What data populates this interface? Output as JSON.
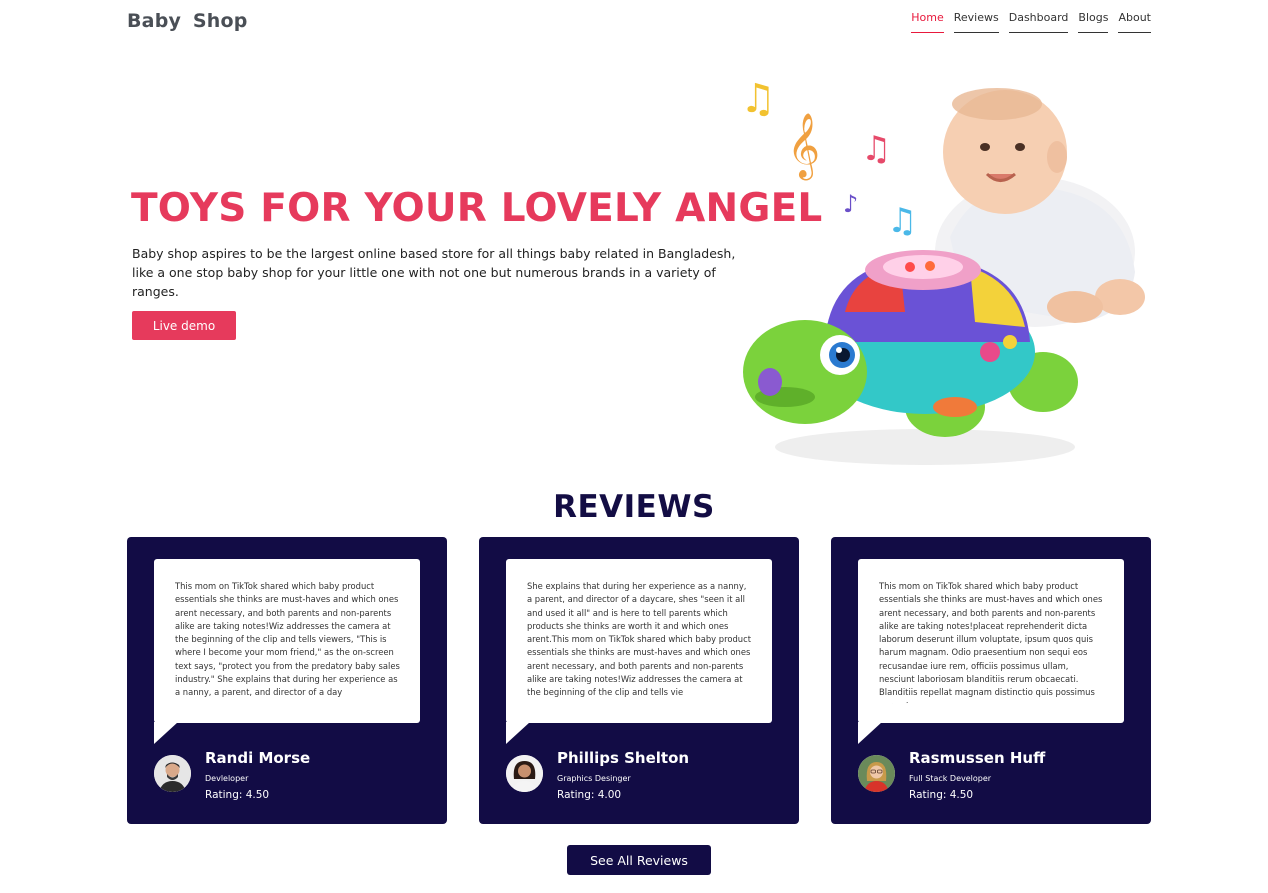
{
  "header": {
    "brand": "Baby  Shop",
    "nav": [
      {
        "label": "Home",
        "active": true
      },
      {
        "label": "Reviews",
        "active": false
      },
      {
        "label": "Dashboard",
        "active": false
      },
      {
        "label": "Blogs",
        "active": false
      },
      {
        "label": "About",
        "active": false
      }
    ]
  },
  "hero": {
    "title": "TOYS FOR YOUR LOVELY ANGEL",
    "description": "Baby shop aspires to be the largest online based store for all things baby related in Bangladesh, like a one stop baby shop for your little one with not one but numerous brands in a variety of ranges.",
    "button_label": "Live demo",
    "image_icon": "baby-with-turtle-toy"
  },
  "reviews": {
    "title": "REVIEWS",
    "items": [
      {
        "text": "This mom on TikTok shared which baby product essentials she thinks are must-haves and which ones arent necessary, and both parents and non-parents alike are taking notes!Wiz addresses the camera at the beginning of the clip and tells viewers, \"This is where I become your mom friend,\" as the on-screen text says, \"protect you from the predatory baby sales industry.\" She explains that during her experience as a nanny, a parent, and director of a day",
        "name": "Randi Morse",
        "role": "Devleloper",
        "rating": "Rating: 4.50"
      },
      {
        "text": "She explains that during her experience as a nanny, a parent, and director of a daycare, shes \"seen it all and used it all\" and is here to tell parents which products she thinks are worth it and which ones arent.This mom on TikTok shared which baby product essentials she thinks are must-haves and which ones arent necessary, and both parents and non-parents alike are taking notes!Wiz addresses the camera at the beginning of the clip and tells vie",
        "name": "Phillips Shelton",
        "role": "Graphics Desinger",
        "rating": "Rating: 4.00"
      },
      {
        "text": "This mom on TikTok shared which baby product essentials she thinks are must-haves and which ones arent necessary, and both parents and non-parents alike are taking notes!placeat reprehenderit dicta laborum deserunt illum voluptate, ipsum quos quis harum magnam. Odio praesentium non sequi eos recusandae iure rem, officiis possimus ullam, nesciunt laboriosam blanditiis rerum obcaecati. Blanditiis repellat magnam distinctio quis possimus corporis qu",
        "name": "Rasmussen Huff",
        "role": "Full Stack Developer",
        "rating": "Rating: 4.50"
      }
    ],
    "see_all_label": "See All Reviews"
  },
  "colors": {
    "accent": "#e63a5c",
    "navy": "#120c45"
  }
}
